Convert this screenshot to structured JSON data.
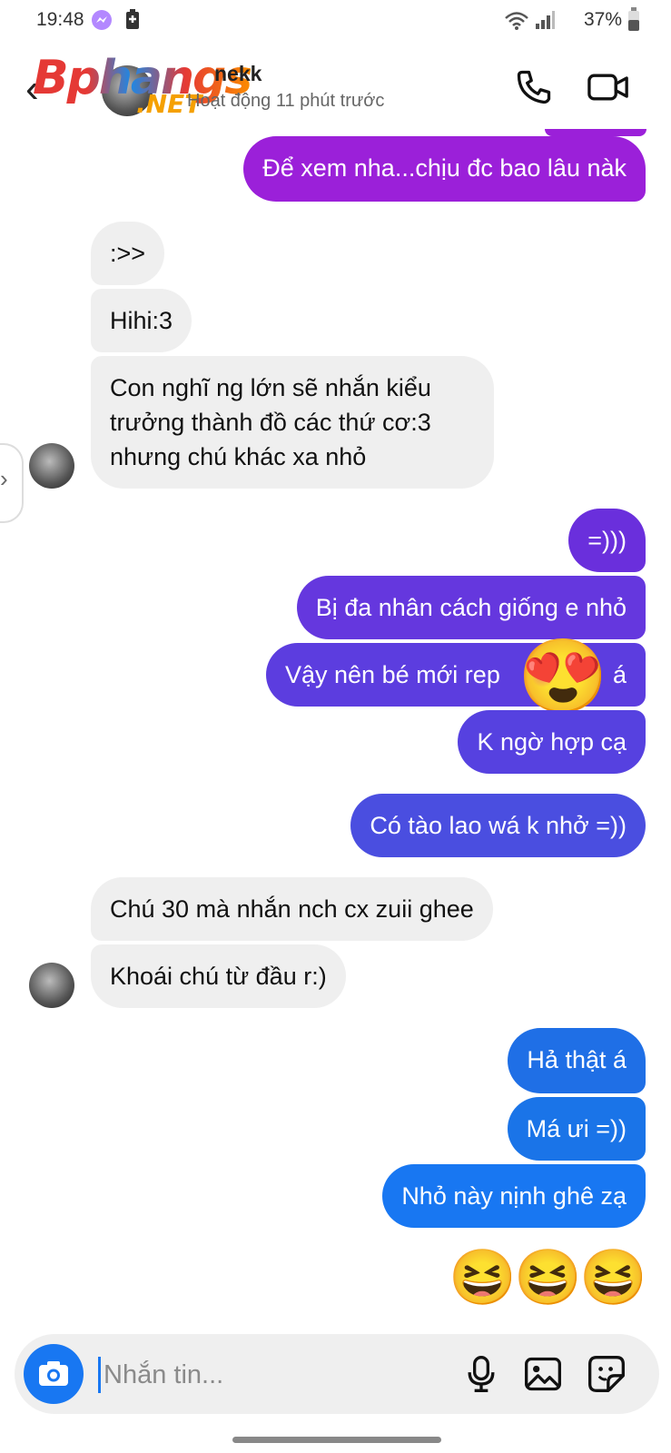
{
  "status_bar": {
    "time": "19:48",
    "battery": "37%"
  },
  "header": {
    "watermark_main": "Bphangs",
    "watermark_net": ".NET",
    "contact_name_visible": "nekk",
    "presence": "Hoạt động 11 phút trước"
  },
  "messages": [
    {
      "dir": "out",
      "text": "Để xem nha...chịu đc bao lâu nàk",
      "color": "#9b20d9"
    },
    {
      "dir": "in",
      "text": ":>>"
    },
    {
      "dir": "in",
      "text": "Hihi:3"
    },
    {
      "dir": "in",
      "lines": [
        "Con nghĩ ng lớn sẽ nhắn kiểu",
        "trưởng thành đồ các thứ cơ:3",
        "nhưng chú khác xa nhỏ"
      ]
    },
    {
      "dir": "out",
      "text": "=)))",
      "color": "#6a2fdc"
    },
    {
      "dir": "out",
      "text": "Bị đa nhân cách giống e nhỏ",
      "color": "#6537de"
    },
    {
      "dir": "out",
      "text": "Vậy nên bé mới rep",
      "text_tail": "á",
      "color": "#5c3ddf"
    },
    {
      "dir": "out",
      "text": "K ngờ hợp cạ",
      "color": "#5641e0"
    },
    {
      "dir": "out",
      "text": "Có tào lao wá k nhở =))",
      "color": "#4a4ee0"
    },
    {
      "dir": "in",
      "text": "Chú 30 mà nhắn nch cx zuii ghee"
    },
    {
      "dir": "in",
      "text": "Khoái chú từ đầu r:)"
    },
    {
      "dir": "out",
      "text": "Hả thật á",
      "color": "#1f6fe6"
    },
    {
      "dir": "out",
      "text": "Má ưi =))",
      "color": "#1a74e8"
    },
    {
      "dir": "out",
      "text": "Nhỏ này nịnh ghê zạ",
      "color": "#1877f2"
    }
  ],
  "reaction_emoji": "😍",
  "sent_emojis": [
    "😆",
    "😆",
    "😆"
  ],
  "composer": {
    "placeholder": "Nhắn tin..."
  },
  "icons": {
    "back": "back-arrow-icon",
    "call": "phone-icon",
    "video": "video-camera-icon",
    "camera": "camera-icon",
    "mic": "microphone-icon",
    "gallery": "image-icon",
    "sticker": "sticker-icon"
  },
  "colors": {
    "incoming_bubble": "#efefef",
    "accent": "#1877f2"
  }
}
